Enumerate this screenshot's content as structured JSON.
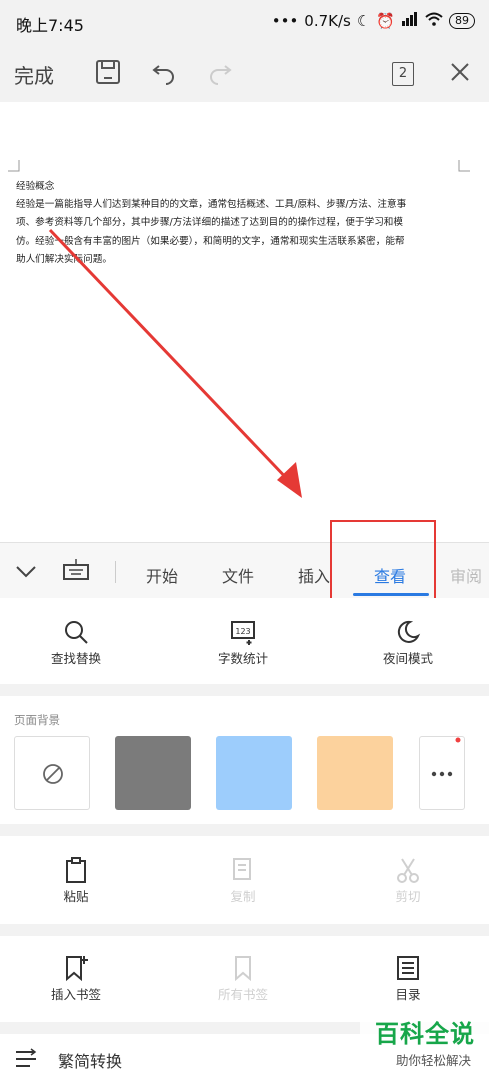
{
  "status": {
    "time": "晚上7:45",
    "speed": "0.7K/s",
    "battery": "89"
  },
  "toolbar": {
    "done_label": "完成",
    "page_count": "2"
  },
  "document": {
    "heading": "经验概念",
    "lines": [
      "经验是一篇能指导人们达到某种目的的文章，通常包括概述、工具/原料、步骤/方法、注意事",
      "项、参考资料等几个部分，其中步骤/方法详细的描述了达到目的的操作过程，便于学习和模",
      "仿。经验一般含有丰富的图片（如果必要），和简明的文字，通常和现实生活联系紧密，能帮",
      "助人们解决实际问题。"
    ]
  },
  "tabs": {
    "start": "开始",
    "file": "文件",
    "insert": "插入",
    "view": "查看",
    "review": "审阅"
  },
  "tools": {
    "find_replace": "查找替换",
    "word_count": "字数统计",
    "night_mode": "夜间模式"
  },
  "page_background": {
    "label": "页面背景",
    "swatches": [
      "#7b7b7b",
      "#9dcdfc",
      "#fcd29d"
    ]
  },
  "clipboard": {
    "paste": "粘贴",
    "copy": "复制",
    "cut": "剪切"
  },
  "bookmarks": {
    "insert_bookmark": "插入书签",
    "all_bookmarks": "所有书签",
    "toc": "目录"
  },
  "convert": {
    "label": "繁简转换"
  },
  "watermark": {
    "title": "百科全说",
    "subtitle": "助你轻松解决"
  },
  "colors": {
    "accent": "#2a7ae2",
    "annotation": "#e53935",
    "brand": "#17a64a"
  }
}
